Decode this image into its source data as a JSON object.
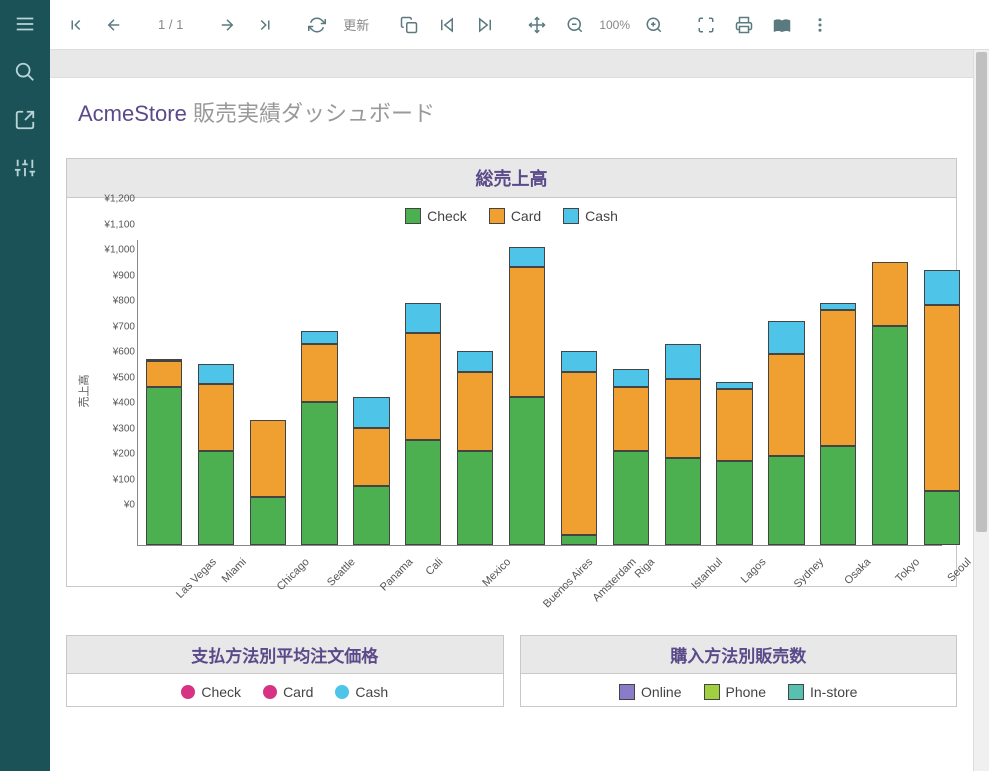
{
  "sidebar": {
    "items": [
      {
        "name": "menu-icon"
      },
      {
        "name": "search-icon"
      },
      {
        "name": "export-icon"
      },
      {
        "name": "settings-icon"
      }
    ]
  },
  "toolbar": {
    "first": "first-page",
    "prev": "prev-page",
    "page_indicator": "1 / 1",
    "next": "next-page",
    "last": "last-page",
    "reload": "reload",
    "update_label": "更新",
    "zoom_label": "100%"
  },
  "report": {
    "brand": "AcmeStore",
    "title_suffix": " 販売実績ダッシュボード"
  },
  "colors": {
    "check": "#4caf50",
    "card": "#f0a030",
    "cash": "#4ec4e8",
    "online": "#8a7cc8",
    "phone": "#a0d040",
    "instore": "#58c0b0",
    "pink": "#d63384"
  },
  "chart_data": {
    "type": "bar",
    "stacked": true,
    "title": "総売上高",
    "ylabel": "売上高",
    "xlabel": "",
    "ylim": [
      0,
      1200
    ],
    "y_ticks": [
      0,
      100,
      200,
      300,
      400,
      500,
      600,
      700,
      800,
      900,
      1000,
      1100,
      1200
    ],
    "y_prefix": "¥",
    "categories": [
      "Las Vegas",
      "Miami",
      "Chicago",
      "Seattle",
      "Panama",
      "Cali",
      "Mexico",
      "Buenos Aires",
      "Amsterdam",
      "Riga",
      "Istanbul",
      "Lagos",
      "Sydney",
      "Osaka",
      "Tokyo",
      "Seoul"
    ],
    "series": [
      {
        "name": "Check",
        "color": "#4caf50",
        "values": [
          620,
          370,
          190,
          560,
          230,
          410,
          370,
          580,
          40,
          370,
          340,
          330,
          350,
          390,
          860,
          210
        ]
      },
      {
        "name": "Card",
        "color": "#f0a030",
        "values": [
          100,
          260,
          300,
          230,
          230,
          420,
          310,
          510,
          640,
          250,
          310,
          280,
          400,
          530,
          250,
          730
        ]
      },
      {
        "name": "Cash",
        "color": "#4ec4e8",
        "values": [
          10,
          80,
          0,
          50,
          120,
          120,
          80,
          80,
          80,
          70,
          140,
          30,
          130,
          30,
          0,
          140
        ]
      }
    ]
  },
  "lower_charts": [
    {
      "title": "支払方法別平均注文価格",
      "legend": [
        {
          "label": "Check",
          "color": "#d63384",
          "shape": "dot"
        },
        {
          "label": "Card",
          "color": "#d63384",
          "shape": "dot"
        },
        {
          "label": "Cash",
          "color": "#4ec4e8",
          "shape": "dot"
        }
      ]
    },
    {
      "title": "購入方法別販売数",
      "legend": [
        {
          "label": "Online",
          "color": "#8a7cc8",
          "shape": "square"
        },
        {
          "label": "Phone",
          "color": "#a0d040",
          "shape": "square"
        },
        {
          "label": "In-store",
          "color": "#58c0b0",
          "shape": "square"
        }
      ]
    }
  ]
}
